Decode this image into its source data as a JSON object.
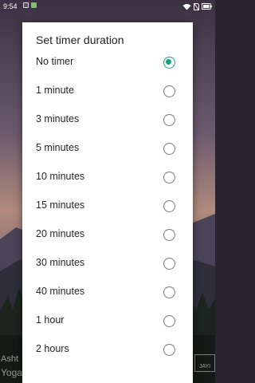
{
  "status_bar": {
    "time": "9:54",
    "icons": [
      "notification-icon",
      "notification-icon",
      "wifi-icon",
      "no-sim-icon",
      "battery-icon"
    ]
  },
  "background": {
    "text_line1": "Asht",
    "text_line2": "Yoga Mudra",
    "badge_text": "JAYI"
  },
  "dialog": {
    "title": "Set timer duration",
    "accent_color": "#1d9e86",
    "selected_index": 0,
    "options": [
      {
        "label": "No timer",
        "selected": true
      },
      {
        "label": "1 minute",
        "selected": false
      },
      {
        "label": "3 minutes",
        "selected": false
      },
      {
        "label": "5 minutes",
        "selected": false
      },
      {
        "label": "10 minutes",
        "selected": false
      },
      {
        "label": "15 minutes",
        "selected": false
      },
      {
        "label": "20 minutes",
        "selected": false
      },
      {
        "label": "30 minutes",
        "selected": false
      },
      {
        "label": "40 minutes",
        "selected": false
      },
      {
        "label": "1 hour",
        "selected": false
      },
      {
        "label": "2 hours",
        "selected": false
      }
    ]
  }
}
